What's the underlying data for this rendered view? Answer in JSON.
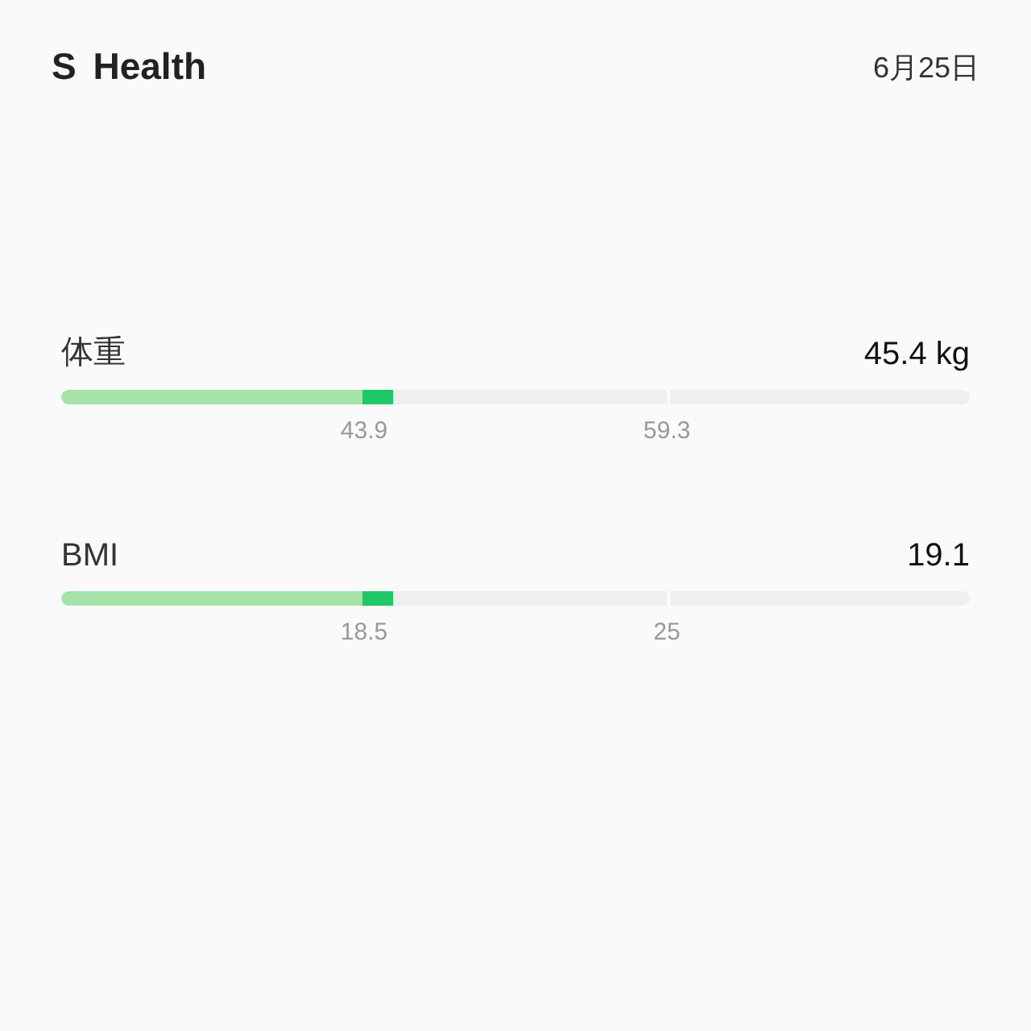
{
  "header": {
    "title": "S Health",
    "date": "6月25日"
  },
  "metrics": [
    {
      "label": "体重",
      "value": "45.4 kg",
      "level": 0.365,
      "ticks": [
        "43.9",
        "59.3"
      ]
    },
    {
      "label": "BMI",
      "value": "19.1",
      "level": 0.365,
      "ticks": [
        "18.5",
        "25"
      ]
    }
  ]
}
